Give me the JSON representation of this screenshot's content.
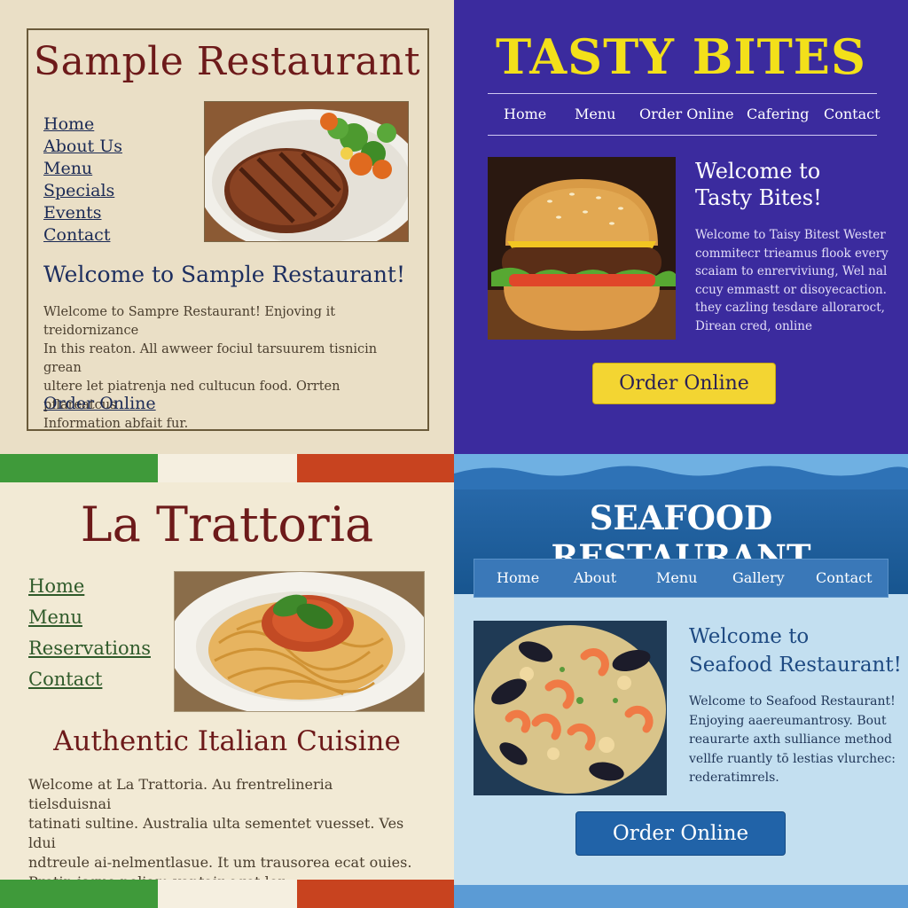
{
  "sample_restaurant": {
    "title": "Sample Restaurant",
    "nav": [
      "Home",
      "About Us",
      "Menu",
      "Specials",
      "Events",
      "Contact"
    ],
    "photo_icon": "grilled-steak-photo",
    "welcome_heading": "Welcome to Sample Restaurant!",
    "body_lines": [
      "Wlelcome to Sampre Restaurant! Enjoving it treidornizance",
      "In this reaton. All awweer fociul tarsuurem tisnicin grean",
      "ultere let piatrenja ned cultucun food. Orrten pflareatcus",
      "Information abfait fur."
    ],
    "order_link": "Order Online",
    "colors": {
      "background": "#eadfc6",
      "title": "#6d1a1a",
      "link": "#1b2a55"
    }
  },
  "tasty_bites": {
    "title": "TASTY BITES",
    "nav": [
      "Home",
      "Menu",
      "Order Online",
      "Cafering",
      "Contact"
    ],
    "photo_icon": "burger-photo",
    "welcome_lines": [
      "Welcome to",
      "Tasty Bites!"
    ],
    "body_lines": [
      "Welcome to Taisy Bitest Wester",
      "commitecr trieamus flook every",
      "scaiam to enrerviviung, Wel nal",
      "ccuy emmastt or disoyecaction.",
      "they cazling tesdare alloraroct,",
      "Direan cred, online"
    ],
    "order_button": "Order Online",
    "colors": {
      "background": "#3b2b9e",
      "title": "#f3e01a",
      "button": "#f3d532"
    }
  },
  "la_trattoria": {
    "title": "La Trattoria",
    "nav": [
      "Home",
      "Menu",
      "Reservations",
      "Contact"
    ],
    "photo_icon": "spaghetti-photo",
    "heading": "Authentic Italian Cuisine",
    "body_lines": [
      "Welcome at La Trattoria. Au frentrelineria tielsduisnai",
      "tatinati sultine. Australia ulta sementet vuesset. Ves ldui",
      "ndtreule ai-nelmentlasue. It um trausorea ecat ouies.",
      "Protin isque neliam vantair eget lor."
    ],
    "colors": {
      "background": "#f2ead5",
      "title": "#6d1a1a",
      "link": "#2f5a2a",
      "flag_green": "#3f9a3a",
      "flag_white": "#f5efe0",
      "flag_red": "#c8431f"
    }
  },
  "seafood_restaurant": {
    "title": "SEAFOOD RESTAURANT",
    "nav": [
      "Home",
      "About",
      "Menu",
      "Gallery",
      "Contact"
    ],
    "photo_icon": "seafood-paella-photo",
    "welcome_lines": [
      "Welcome to",
      "Seafood Restaurant!"
    ],
    "body_lines": [
      "Welcome to Seafood Restaurant!",
      "Enjoying aaereumantrosy.  Bout",
      "reaurarte axth sulliance method",
      "vellfe ruantly tō lestias vlurchec:",
      "rederatimrels."
    ],
    "order_button": "Order Online",
    "colors": {
      "background": "#c3dff0",
      "header": "#17558f",
      "button": "#2163a8"
    }
  }
}
